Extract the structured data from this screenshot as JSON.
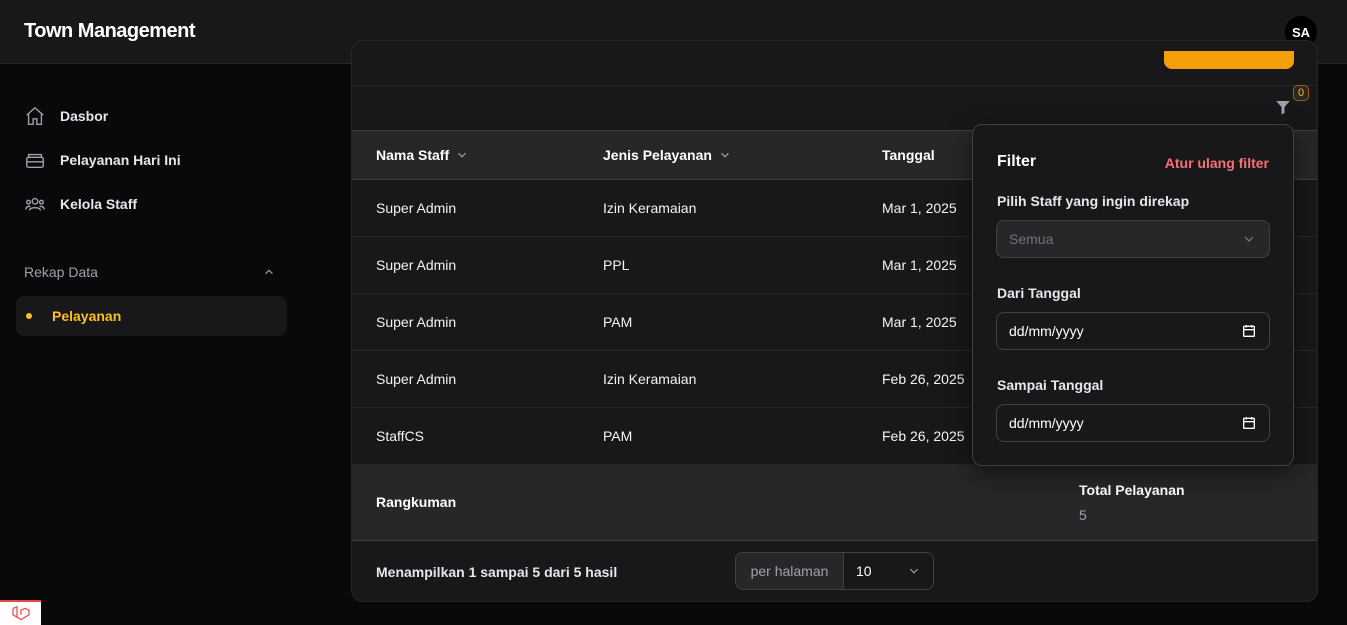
{
  "app": {
    "title": "Town Management",
    "user_initials": "SA"
  },
  "sidebar": {
    "items": [
      {
        "label": "Dasbor",
        "icon": "home-icon"
      },
      {
        "label": "Pelayanan Hari Ini",
        "icon": "inbox-stack-icon"
      },
      {
        "label": "Kelola Staff",
        "icon": "users-icon"
      }
    ],
    "group": {
      "label": "Rekap Data",
      "icon": "chevron-up-icon"
    },
    "group_items": [
      {
        "label": "Pelayanan",
        "active": true
      }
    ]
  },
  "toolbar": {
    "filter_count": "0"
  },
  "table": {
    "columns": [
      {
        "label": "Nama Staff",
        "sortable": true
      },
      {
        "label": "Jenis Pelayanan",
        "sortable": true
      },
      {
        "label": "Tanggal",
        "sortable": false
      }
    ],
    "rows": [
      [
        "Super Admin",
        "Izin Keramaian",
        "Mar 1, 2025"
      ],
      [
        "Super Admin",
        "PPL",
        "Mar 1, 2025"
      ],
      [
        "Super Admin",
        "PAM",
        "Mar 1, 2025"
      ],
      [
        "Super Admin",
        "Izin Keramaian",
        "Feb 26, 2025"
      ],
      [
        "StaffCS",
        "PAM",
        "Feb 26, 2025"
      ]
    ],
    "summary": {
      "label": "Rangkuman",
      "total_label": "Total Pelayanan",
      "total_value": "5"
    }
  },
  "pagination": {
    "info": "Menampilkan 1 sampai 5 dari 5 hasil",
    "per_page_label": "per halaman",
    "per_page_value": "10"
  },
  "filter": {
    "title": "Filter",
    "reset_label": "Atur ulang filter",
    "staff_label": "Pilih Staff yang ingin direkap",
    "staff_value": "Semua",
    "from_label": "Dari Tanggal",
    "from_placeholder": "dd/mm/yyyy",
    "to_label": "Sampai Tanggal",
    "to_placeholder": "dd/mm/yyyy"
  },
  "colors": {
    "accent": "#fbbf24",
    "danger": "#f87171",
    "background": "#09090b",
    "surface": "#18181b"
  }
}
